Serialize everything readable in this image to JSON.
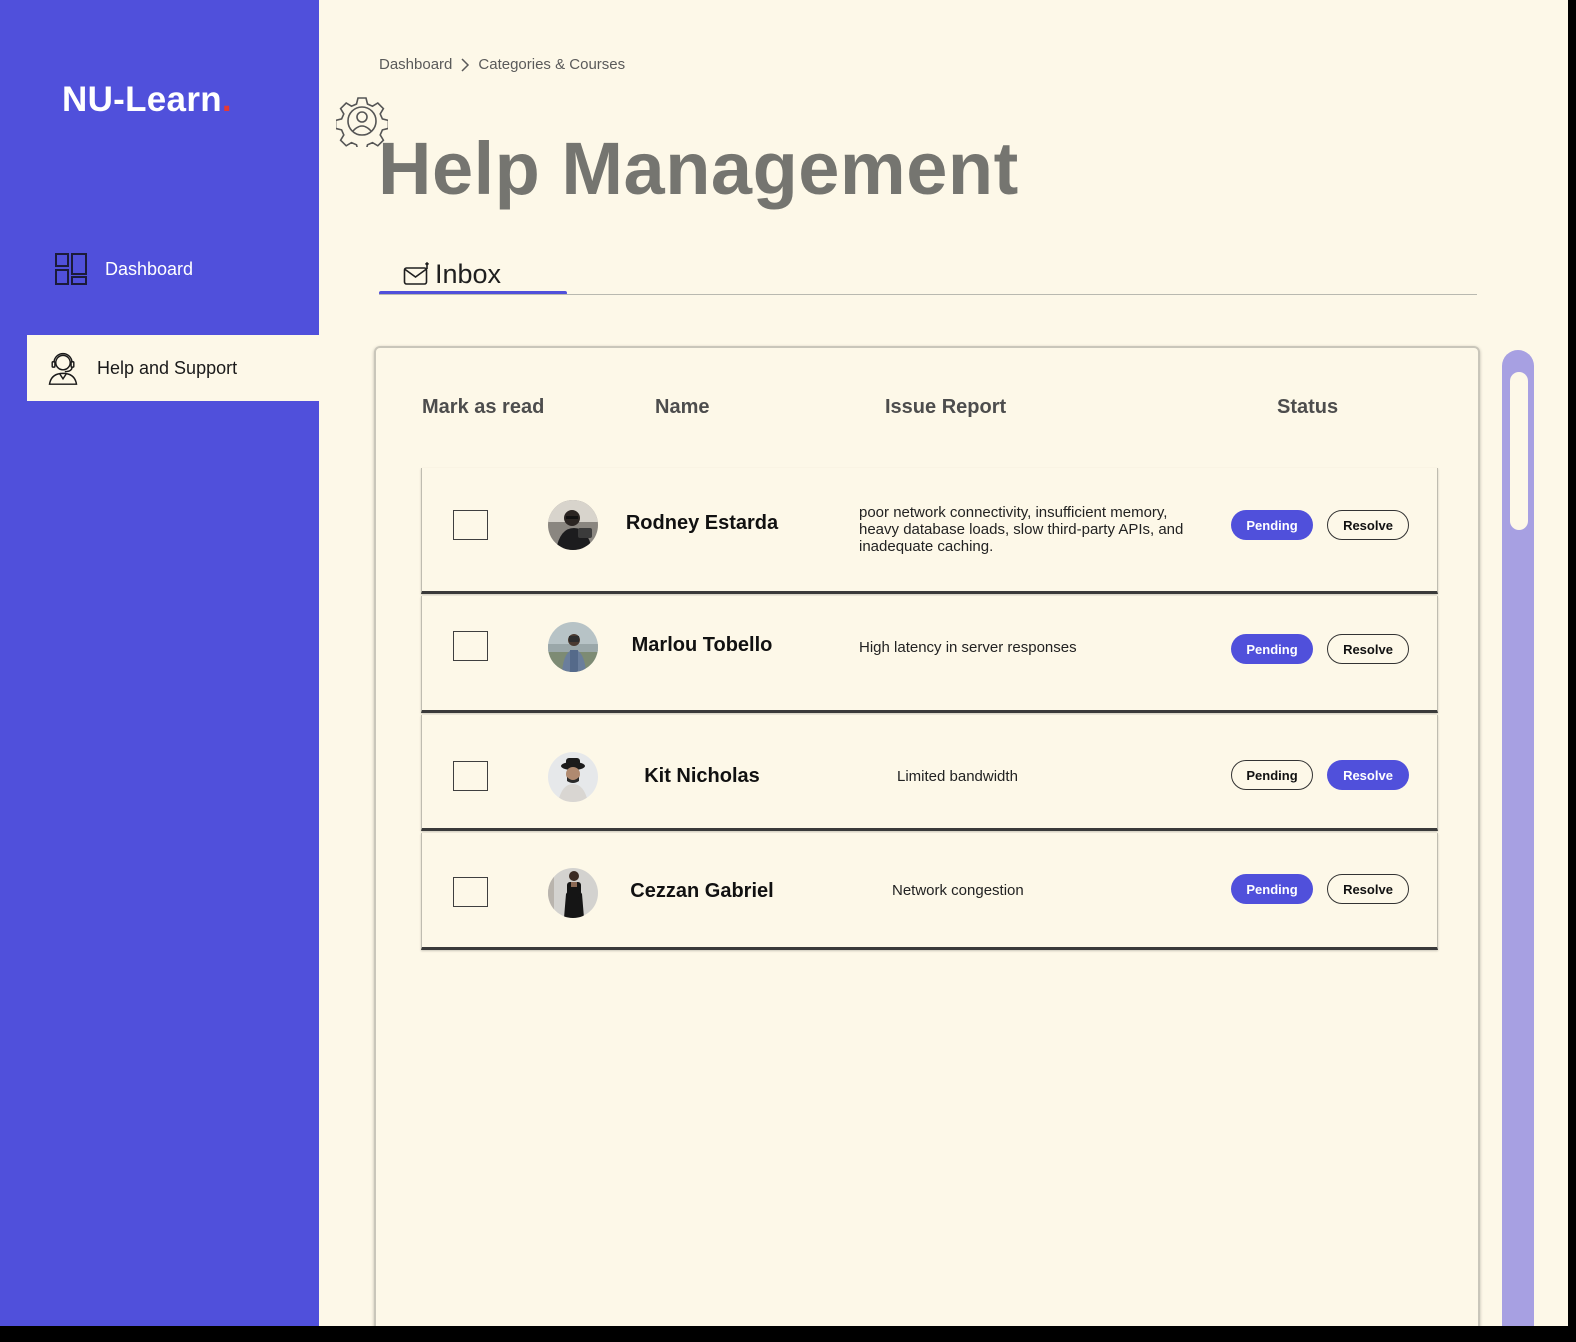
{
  "app": {
    "logo_text": "NU-Learn",
    "logo_dot": ".",
    "brand_color": "#5050db",
    "accent_dot_color": "#e53935"
  },
  "sidebar": {
    "items": [
      {
        "label": "Dashboard",
        "icon": "grid-icon",
        "active": false
      },
      {
        "label": "Help and Support",
        "icon": "support-agent-icon",
        "active": true
      }
    ]
  },
  "breadcrumb": {
    "items": [
      "Dashboard",
      "Categories & Courses"
    ],
    "separator_icon": "chevron-right-icon"
  },
  "page": {
    "title": "Help Management",
    "title_icon": "gear-person-icon"
  },
  "tabs": [
    {
      "label": "Inbox",
      "icon": "mail-icon",
      "active": true
    }
  ],
  "table": {
    "headers": {
      "mark": "Mark as read",
      "name": "Name",
      "issue": "Issue Report",
      "status": "Status"
    },
    "rows": [
      {
        "name": "Rodney Estarda",
        "issue": "poor network connectivity, insufficient memory, heavy database loads, slow third-party APIs, and inadequate caching.",
        "pending_label": "Pending",
        "resolve_label": "Resolve",
        "status": "Pending",
        "checked": false
      },
      {
        "name": "Marlou Tobello",
        "issue": "High latency in server responses",
        "pending_label": "Pending",
        "resolve_label": "Resolve",
        "status": "Pending",
        "checked": false
      },
      {
        "name": "Kit Nicholas",
        "issue": "Limited bandwidth",
        "pending_label": "Pending",
        "resolve_label": "Resolve",
        "status": "Resolve",
        "checked": false
      },
      {
        "name": "Cezzan Gabriel",
        "issue": "Network congestion",
        "pending_label": "Pending",
        "resolve_label": "Resolve",
        "status": "Pending",
        "checked": false
      }
    ]
  }
}
